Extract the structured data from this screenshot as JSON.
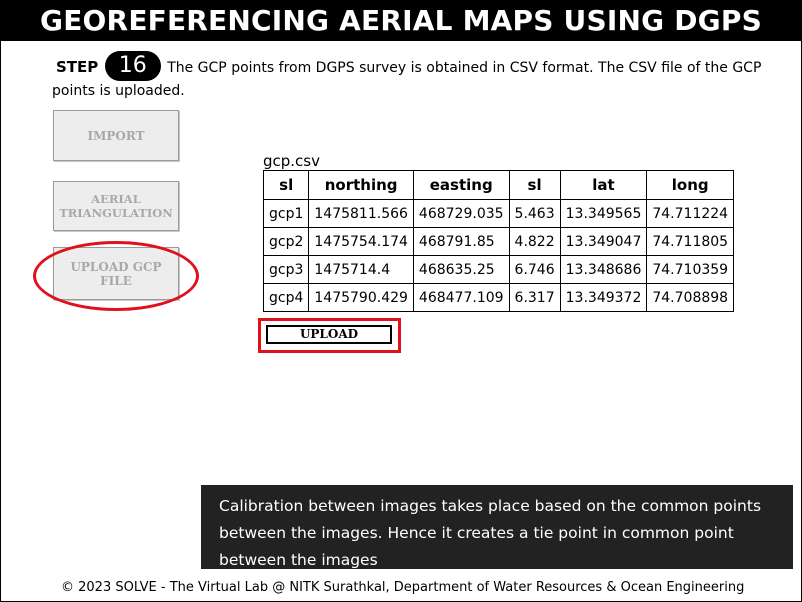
{
  "header": {
    "title": "GEOREFERENCING AERIAL MAPS USING DGPS"
  },
  "step": {
    "label": "STEP",
    "number": "16",
    "text_line1": "The GCP points from DGPS survey is obtained in CSV format. The CSV file of the GCP",
    "text_line2": "points is uploaded."
  },
  "sidebar": {
    "import_label": "IMPORT",
    "aerial_label": "AERIAL TRIANGULATION",
    "upload_gcp_label": "UPLOAD GCP FILE"
  },
  "file": {
    "name": "gcp.csv",
    "columns": [
      "sl",
      "northing",
      "easting",
      "sl",
      "lat",
      "long"
    ],
    "rows": [
      [
        "gcp1",
        "1475811.566",
        "468729.035",
        "5.463",
        "13.349565",
        "74.711224"
      ],
      [
        "gcp2",
        "1475754.174",
        "468791.85",
        "4.822",
        "13.349047",
        "74.711805"
      ],
      [
        "gcp3",
        "1475714.4",
        "468635.25",
        "6.746",
        "13.348686",
        "74.710359"
      ],
      [
        "gcp4",
        "1475790.429",
        "468477.109",
        "6.317",
        "13.349372",
        "74.708898"
      ]
    ]
  },
  "upload": {
    "label": "UPLOAD"
  },
  "tooltip": {
    "text": "Calibration between images takes place based on the common points between the images. Hence it creates a tie point in common point between the images"
  },
  "footer": {
    "text": "© 2023 SOLVE - The Virtual Lab @ NITK Surathkal, Department of Water Resources & Ocean Engineering"
  },
  "colors": {
    "highlight": "#e0111b",
    "header_bg": "#000000",
    "tooltip_bg": "#222222"
  }
}
